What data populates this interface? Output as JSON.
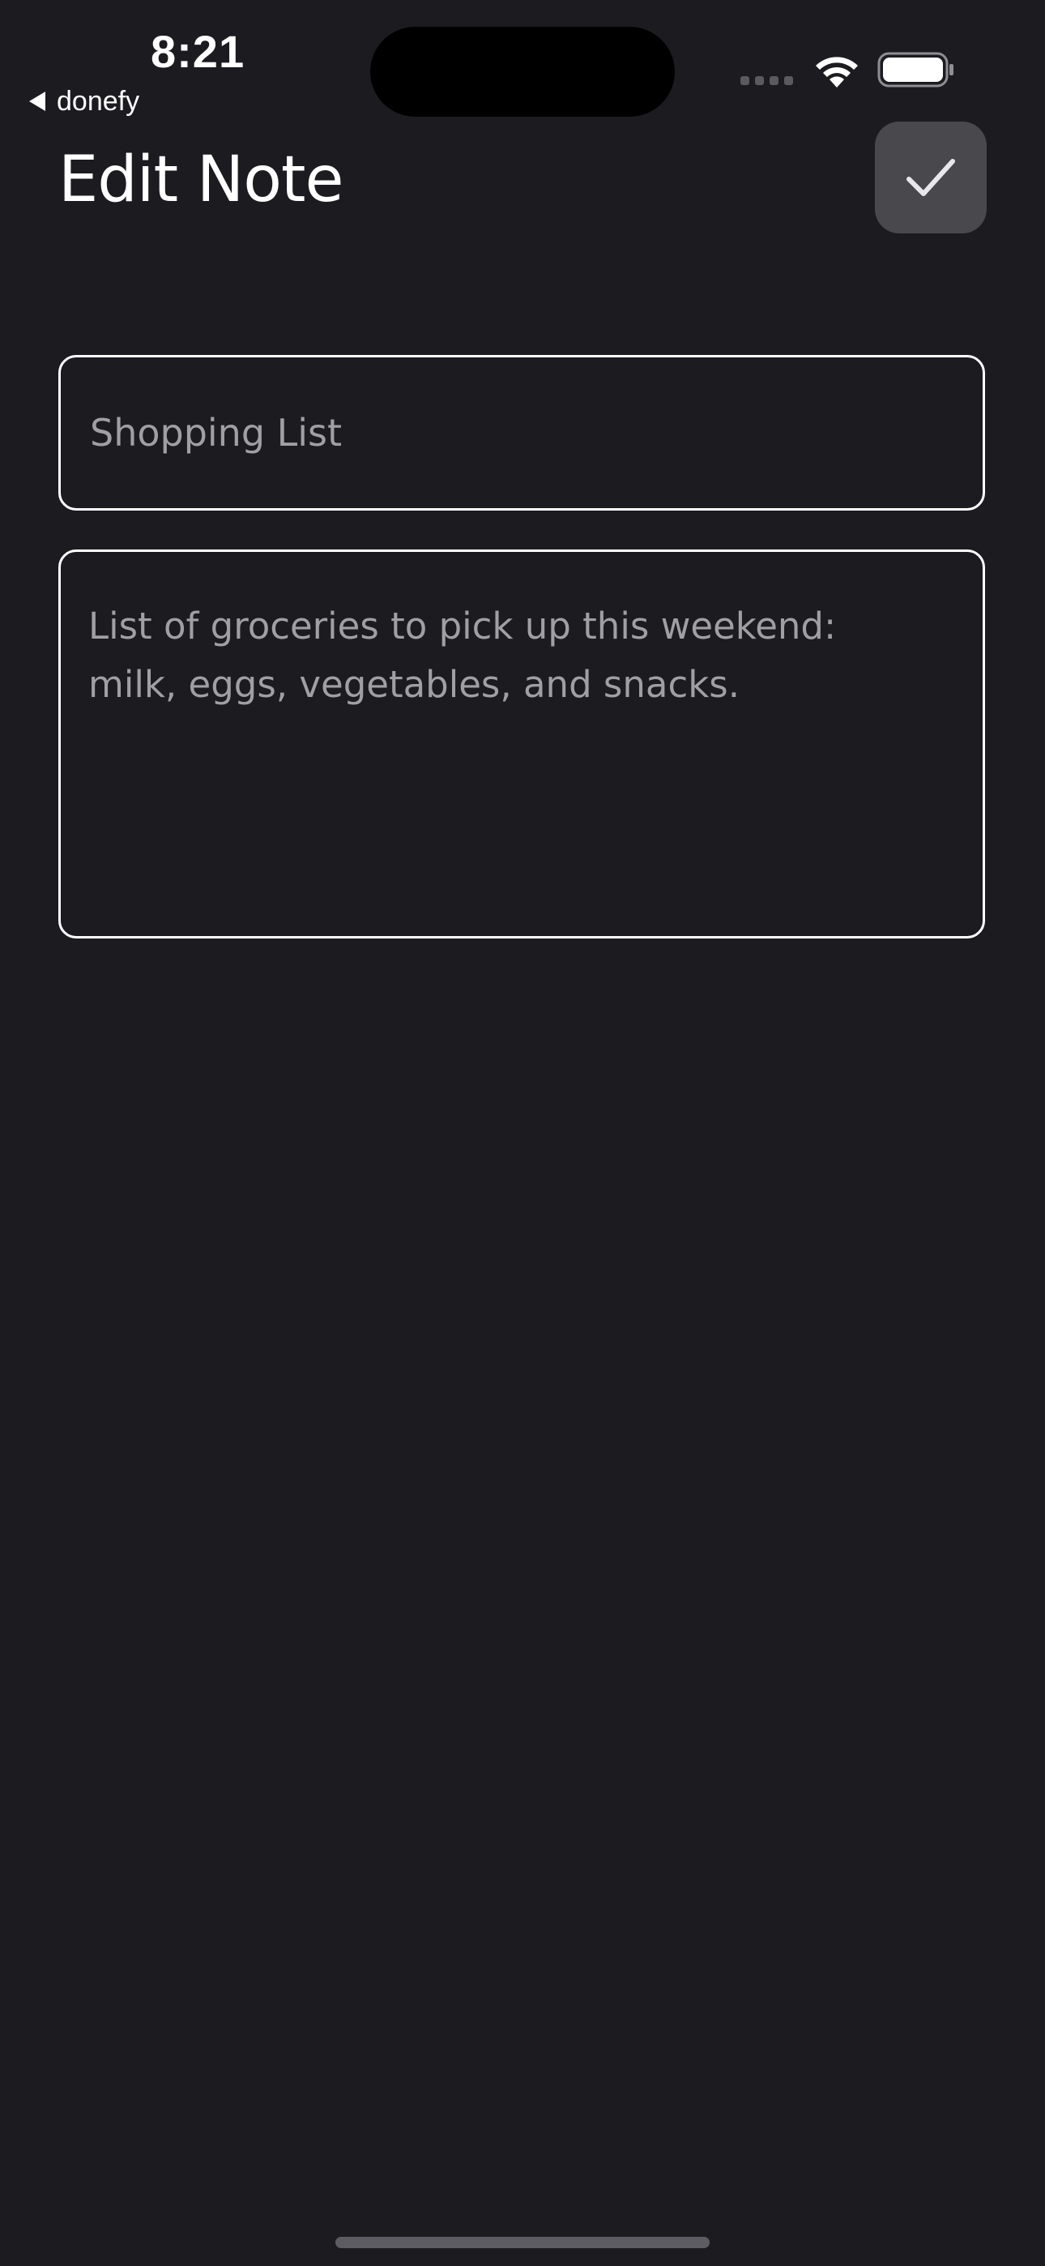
{
  "status_bar": {
    "time": "8:21",
    "back_label": "donefy",
    "icons": [
      "signal-icon",
      "wifi-icon",
      "battery-icon"
    ]
  },
  "header": {
    "title": "Edit Note",
    "save_icon": "check-icon"
  },
  "form": {
    "title_value": "Shopping List",
    "content_value": "List of groceries to pick up this weekend:\nmilk, eggs, vegetables, and snacks."
  },
  "colors": {
    "background": "#1c1b20",
    "button": "#49484d",
    "field_text": "#a09fa4",
    "field_border": "#ffffff"
  }
}
